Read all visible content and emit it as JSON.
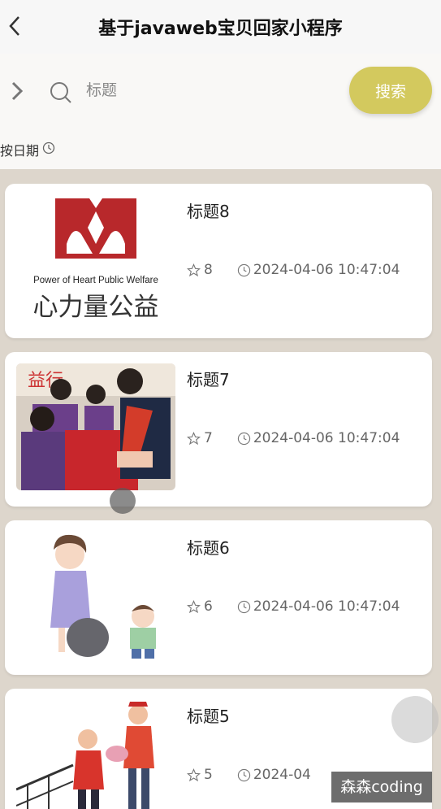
{
  "nav": {
    "title": "基于javaweb宝贝回家小程序",
    "back_icon": "chevron-left-icon"
  },
  "search": {
    "placeholder": "标题",
    "button_label": "搜索",
    "accent_color": "#d3c95e"
  },
  "sort": {
    "label": "按日期"
  },
  "cards": [
    {
      "title": "标题8",
      "likes": "8",
      "datetime": "2024-04-06 10:47:04",
      "image": "power-of-heart-logo"
    },
    {
      "title": "标题7",
      "likes": "7",
      "datetime": "2024-04-06 10:47:04",
      "image": "volunteers-photo"
    },
    {
      "title": "标题6",
      "likes": "6",
      "datetime": "2024-04-06 10:47:04",
      "image": "recycling-illustration"
    },
    {
      "title": "标题5",
      "likes": "5",
      "datetime": "2024-04",
      "image": "volunteers-illustration"
    }
  ],
  "logo": {
    "caption_en": "Power of Heart Public Welfare",
    "caption_cn": "心力量公益"
  },
  "photo_sign": "益行",
  "watermark": "森森coding"
}
